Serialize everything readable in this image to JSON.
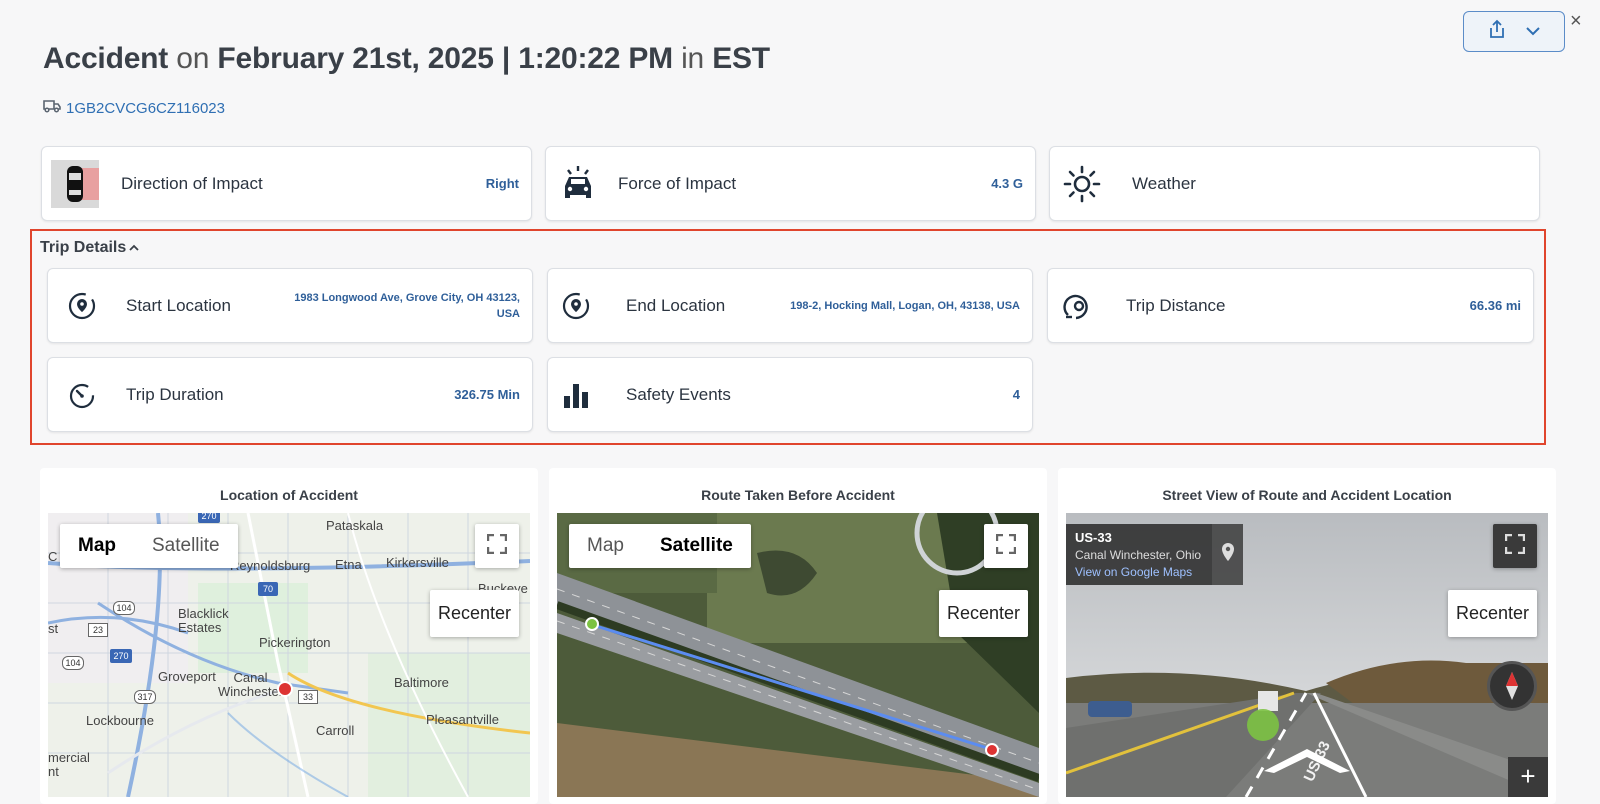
{
  "header": {
    "event_type": "Accident",
    "on": "on",
    "datetime": "February 21st, 2025 | 1:20:22 PM",
    "in": "in",
    "timezone": "EST",
    "vin": "1GB2CVCG6CZ116023"
  },
  "actions": {
    "share_icon": "share-icon",
    "dropdown_icon": "chevron-down-icon",
    "close": "×"
  },
  "impact_cards": [
    {
      "label": "Direction of Impact",
      "value": "Right",
      "icon": "car-impact-direction-icon"
    },
    {
      "label": "Force of Impact",
      "value": "4.3 G",
      "icon": "car-alert-icon"
    },
    {
      "label": "Weather",
      "value": "",
      "icon": "sun-icon"
    }
  ],
  "trip": {
    "title": "Trip Details",
    "start_location": {
      "label": "Start Location",
      "value": "1983 Longwood Ave, Grove City, OH 43123, USA"
    },
    "end_location": {
      "label": "End Location",
      "value": "198-2, Hocking Mall, Logan, OH, 43138, USA"
    },
    "distance": {
      "label": "Trip Distance",
      "value": "66.36 mi"
    },
    "duration": {
      "label": "Trip Duration",
      "value": "326.75 Min"
    },
    "safety_events": {
      "label": "Safety Events",
      "value": "4"
    }
  },
  "panels": {
    "location": {
      "title": "Location of Accident"
    },
    "route": {
      "title": "Route Taken Before Accident"
    },
    "street": {
      "title": "Street View of Route and Accident Location"
    }
  },
  "map_controls": {
    "map": "Map",
    "satellite": "Satellite",
    "recenter": "Recenter"
  },
  "map_labels": {
    "pataskala": "Pataskala",
    "reynoldsburg": "Reynoldsburg",
    "etna": "Etna",
    "kirkersville": "Kirkersville",
    "blacklick": "Blacklick\nEstates",
    "pickerington": "Pickerington",
    "groveport": "Groveport",
    "canal": "Canal\nWinchester",
    "baltimore": "Baltimore",
    "lockbourne": "Lockbourne",
    "carroll": "Carroll",
    "pleasantville": "Pleasantville",
    "commercial": "mercial\nnt",
    "st": "st",
    "c": "C",
    "buckeye": "Buckeye",
    "r70": "70",
    "r270a": "270",
    "r270b": "270",
    "r104a": "104",
    "r104b": "104",
    "r23": "23",
    "r317": "317",
    "r33": "33"
  },
  "street_view": {
    "road": "US-33",
    "place": "Canal Winchester, Ohio",
    "link": "View on Google Maps",
    "road_marking": "US-33"
  }
}
